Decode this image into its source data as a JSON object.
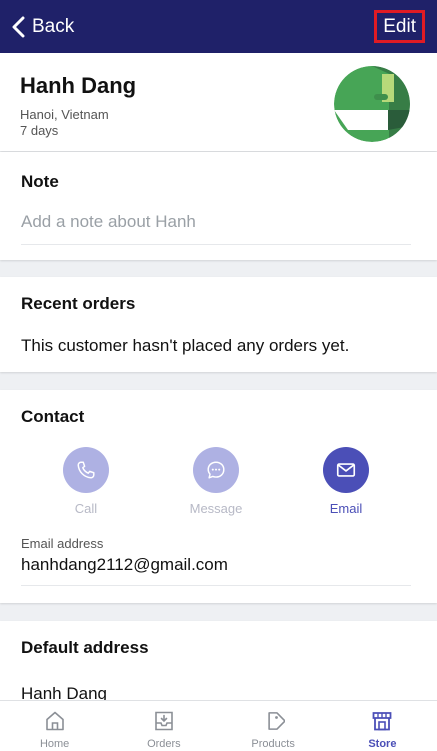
{
  "navbar": {
    "back_label": "Back",
    "edit_label": "Edit"
  },
  "customer": {
    "name": "Hanh Dang",
    "location": "Hanoi, Vietnam",
    "since": "7 days"
  },
  "note": {
    "title": "Note",
    "placeholder": "Add a note about Hanh"
  },
  "recent_orders": {
    "title": "Recent orders",
    "empty_message": "This customer hasn't placed any orders yet."
  },
  "contact": {
    "title": "Contact",
    "actions": [
      {
        "label": "Call",
        "icon": "phone-icon"
      },
      {
        "label": "Message",
        "icon": "chat-icon"
      },
      {
        "label": "Email",
        "icon": "mail-icon"
      }
    ],
    "email_label": "Email address",
    "email_value": "hanhdang2112@gmail.com"
  },
  "default_address": {
    "title": "Default address",
    "name": "Hanh Dang"
  },
  "tabbar": {
    "tabs": [
      {
        "label": "Home",
        "icon": "home-icon"
      },
      {
        "label": "Orders",
        "icon": "orders-icon"
      },
      {
        "label": "Products",
        "icon": "tag-icon"
      },
      {
        "label": "Store",
        "icon": "store-icon"
      }
    ],
    "active": "Store"
  },
  "colors": {
    "navbar": "#1f2169",
    "accent": "#4b4fb7",
    "accent_light": "#aeb1e3",
    "edit_highlight": "#e01b24"
  }
}
